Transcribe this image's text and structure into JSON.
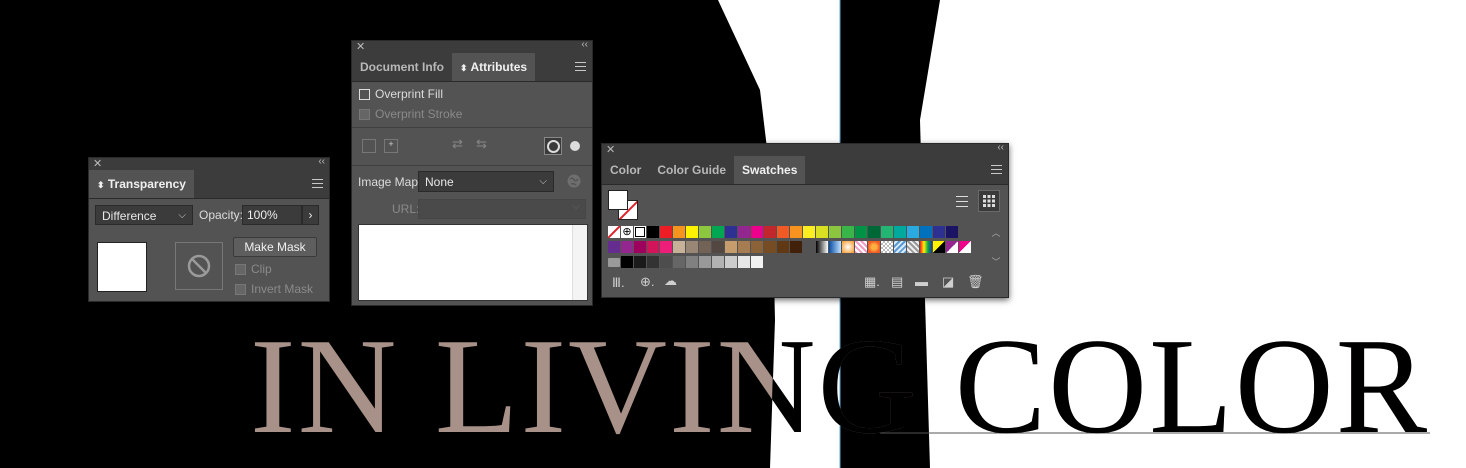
{
  "canvas": {
    "headline": "IN LIVING COLOR",
    "headline_color": "#a89188"
  },
  "transparency": {
    "tab_label": "Transparency",
    "blend_mode": "Difference",
    "opacity_label": "Opacity:",
    "opacity_value": "100%",
    "make_mask_label": "Make Mask",
    "clip_label": "Clip",
    "invert_mask_label": "Invert Mask"
  },
  "attributes": {
    "tabs": [
      {
        "label": "Document Info"
      },
      {
        "label": "Attributes"
      }
    ],
    "overprint_fill_label": "Overprint Fill",
    "overprint_stroke_label": "Overprint Stroke",
    "image_map_label": "Image Map:",
    "image_map_value": "None",
    "url_label": "URL:"
  },
  "swatches": {
    "tabs": [
      {
        "label": "Color"
      },
      {
        "label": "Color Guide"
      },
      {
        "label": "Swatches"
      }
    ],
    "row1_colors": [
      "#ee1c24",
      "#f7941d",
      "#fff200",
      "#8dc63f",
      "#00a651",
      "#2e3192",
      "#92278f",
      "#ec008c",
      "#c1272d",
      "#f15a24",
      "#f7931e",
      "#fcee21",
      "#d9e021",
      "#8cc63f",
      "#39b54a",
      "#009245",
      "#006837",
      "#22b573",
      "#00a99d",
      "#29abe2",
      "#0071bc",
      "#2e3192",
      "#1b1464"
    ],
    "row2_colors": [
      "#662d91",
      "#93278f",
      "#9e005d",
      "#d4145a",
      "#ed1e79",
      "#c7b299",
      "#998675",
      "#736357",
      "#534741",
      "#c69c6d",
      "#a67c52",
      "#8c6239",
      "#754c24",
      "#603813",
      "#42210b"
    ],
    "row3_colors": [
      "#000000",
      "#1a1a1a",
      "#333333",
      "#4d4d4d",
      "#666666",
      "#808080",
      "#999999",
      "#b3b3b3",
      "#cccccc",
      "#e6e6e6",
      "#f2f2f2"
    ]
  }
}
